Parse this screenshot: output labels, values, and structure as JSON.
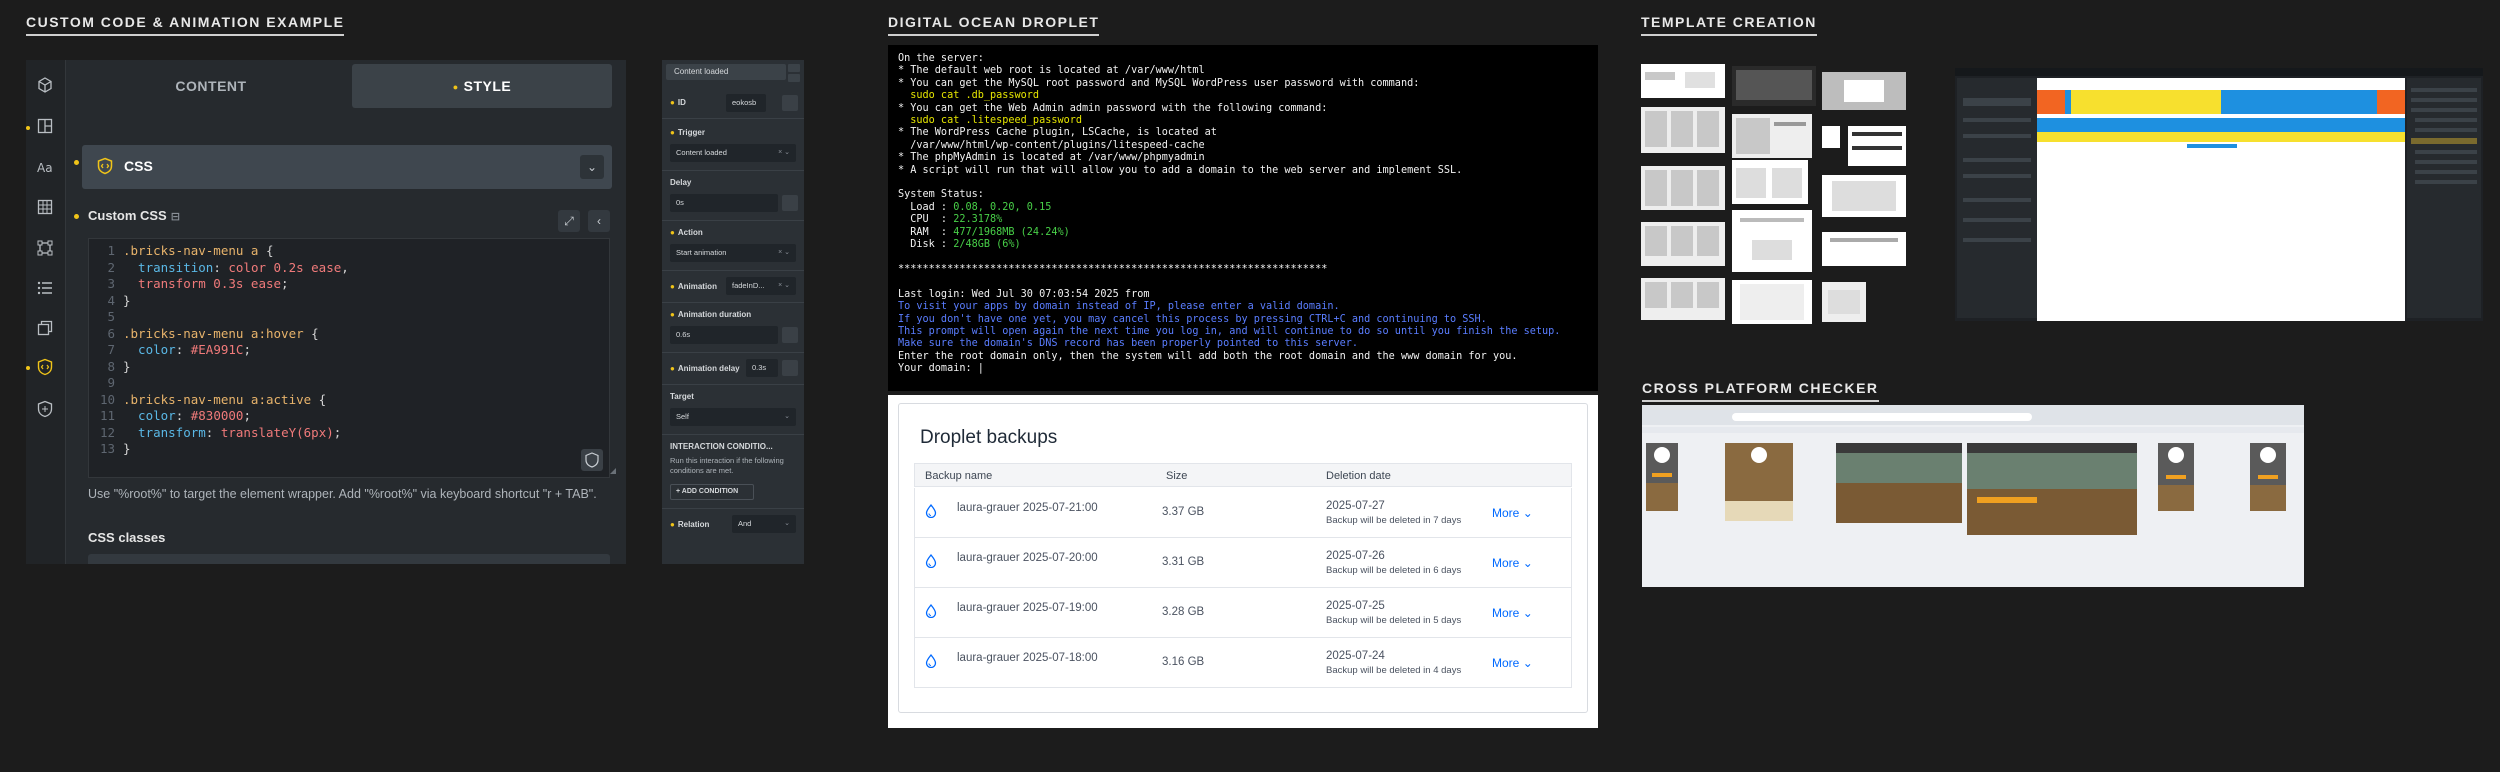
{
  "sections": {
    "custom_code": "CUSTOM CODE & ANIMATION EXAMPLE",
    "droplet": "DIGITAL OCEAN DROPLET",
    "template": "TEMPLATE CREATION",
    "cross": "CROSS PLATFORM CHECKER"
  },
  "editor": {
    "tabs": {
      "content": "CONTENT",
      "style": "STYLE"
    },
    "css_group": "CSS",
    "custom_css_label": "Custom CSS",
    "code_lines": [
      {
        "n": "1",
        "parts": [
          [
            "sel",
            ".bricks-nav-menu a "
          ],
          [
            "punct",
            "{"
          ]
        ]
      },
      {
        "n": "2",
        "parts": [
          [
            "prop",
            "  transition"
          ],
          [
            "punct",
            ": "
          ],
          [
            "val",
            "color 0.2s ease"
          ],
          [
            "punct",
            ","
          ]
        ]
      },
      {
        "n": "3",
        "parts": [
          [
            "val",
            "  transform 0.3s ease"
          ],
          [
            "punct",
            ";"
          ]
        ]
      },
      {
        "n": "4",
        "parts": [
          [
            "punct",
            "}"
          ]
        ]
      },
      {
        "n": "5",
        "parts": []
      },
      {
        "n": "6",
        "parts": [
          [
            "sel",
            ".bricks-nav-menu a:hover "
          ],
          [
            "punct",
            "{"
          ]
        ]
      },
      {
        "n": "7",
        "parts": [
          [
            "prop",
            "  color"
          ],
          [
            "punct",
            ": "
          ],
          [
            "val",
            "#EA991C"
          ],
          [
            "punct",
            ";"
          ]
        ]
      },
      {
        "n": "8",
        "parts": [
          [
            "punct",
            "}"
          ]
        ]
      },
      {
        "n": "9",
        "parts": []
      },
      {
        "n": "10",
        "parts": [
          [
            "sel",
            ".bricks-nav-menu a:active "
          ],
          [
            "punct",
            "{"
          ]
        ]
      },
      {
        "n": "11",
        "parts": [
          [
            "prop",
            "  color"
          ],
          [
            "punct",
            ": "
          ],
          [
            "val",
            "#830000"
          ],
          [
            "punct",
            ";"
          ]
        ]
      },
      {
        "n": "12",
        "parts": [
          [
            "prop",
            "  transform"
          ],
          [
            "punct",
            ": "
          ],
          [
            "val",
            "translateY(6px)"
          ],
          [
            "punct",
            ";"
          ]
        ]
      },
      {
        "n": "13",
        "parts": [
          [
            "punct",
            "}"
          ]
        ]
      }
    ],
    "hint": "Use \"%root%\" to target the element wrapper. Add \"%root%\" via keyboard shortcut \"r + TAB\".",
    "css_classes_label": "CSS classes"
  },
  "interaction": {
    "header": "Content loaded",
    "id_label": "ID",
    "id_value": "eokosb",
    "trigger_label": "Trigger",
    "trigger_value": "Content loaded",
    "delay_label": "Delay",
    "delay_value": "0s",
    "action_label": "Action",
    "action_value": "Start animation",
    "animation_label": "Animation",
    "animation_value": "fadeInD...",
    "duration_label": "Animation duration",
    "duration_value": "0.6s",
    "anim_delay_label": "Animation delay",
    "anim_delay_value": "0.3s",
    "target_label": "Target",
    "target_value": "Self",
    "conditions_title": "INTERACTION CONDITIO...",
    "conditions_desc": "Run this interaction if the following conditions are met.",
    "add_condition": "+ ADD CONDITION",
    "relation_label": "Relation",
    "relation_value": "And"
  },
  "terminal": {
    "lines": [
      [
        "w",
        "On the server:"
      ],
      [
        "w",
        "* The default web root is located at /var/www/html"
      ],
      [
        "w",
        "* You can get the MySQL root password and MySQL WordPress user password with command:"
      ],
      [
        "y",
        "  sudo cat .db_password"
      ],
      [
        "w",
        "* You can get the Web Admin admin password with the following command:"
      ],
      [
        "y",
        "  sudo cat .litespeed_password"
      ],
      [
        "w",
        "* The WordPress Cache plugin, LSCache, is located at"
      ],
      [
        "w",
        "  /var/www/html/wp-content/plugins/litespeed-cache"
      ],
      [
        "w",
        "* The phpMyAdmin is located at /var/www/phpmyadmin"
      ],
      [
        "w",
        "* A script will run that will allow you to add a domain to the web server and implement SSL."
      ],
      [
        "w",
        ""
      ],
      [
        "w",
        "System Status:"
      ],
      [
        "kv",
        "  Load : ",
        "0.08, 0.20, 0.15"
      ],
      [
        "kv",
        "  CPU  : ",
        "22.3178%"
      ],
      [
        "kv",
        "  RAM  : ",
        "477/1968MB (24.24%)"
      ],
      [
        "kv",
        "  Disk : ",
        "2/48GB (6%)"
      ],
      [
        "w",
        ""
      ],
      [
        "w",
        "**********************************************************************"
      ],
      [
        "w",
        ""
      ],
      [
        "w",
        "Last login: Wed Jul 30 07:03:54 2025 from"
      ],
      [
        "b",
        "To visit your apps by domain instead of IP, please enter a valid domain."
      ],
      [
        "b",
        "If you don't have one yet, you may cancel this process by pressing CTRL+C and continuing to SSH."
      ],
      [
        "b",
        "This prompt will open again the next time you log in, and will continue to do so until you finish the setup."
      ],
      [
        "b",
        "Make sure the domain's DNS record has been properly pointed to this server."
      ],
      [
        "w",
        "Enter the root domain only, then the system will add both the root domain and the www domain for you."
      ],
      [
        "w",
        "Your domain: |"
      ]
    ]
  },
  "backups": {
    "title": "Droplet backups",
    "headers": {
      "name": "Backup name",
      "size": "Size",
      "deletion": "Deletion date"
    },
    "rows": [
      {
        "name": "laura-grauer 2025-07-21:00",
        "size": "3.37 GB",
        "date": "2025-07-27",
        "note": "Backup will be deleted in 7 days",
        "more": "More"
      },
      {
        "name": "laura-grauer 2025-07-20:00",
        "size": "3.31 GB",
        "date": "2025-07-26",
        "note": "Backup will be deleted in 6 days",
        "more": "More"
      },
      {
        "name": "laura-grauer 2025-07-19:00",
        "size": "3.28 GB",
        "date": "2025-07-25",
        "note": "Backup will be deleted in 5 days",
        "more": "More"
      },
      {
        "name": "laura-grauer 2025-07-18:00",
        "size": "3.16 GB",
        "date": "2025-07-24",
        "note": "Backup will be deleted in 4 days",
        "more": "More"
      }
    ]
  },
  "colors": {
    "accent": "#f0c419",
    "link": "#0069ff",
    "orange": "#f26522",
    "yellow": "#f7e02e",
    "blue": "#1e90e0"
  }
}
